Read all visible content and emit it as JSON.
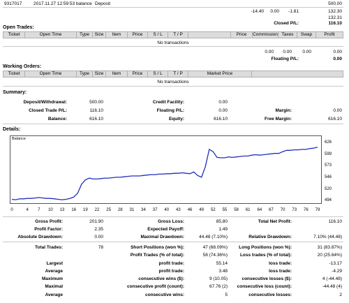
{
  "header": {
    "account": "9317017",
    "datetime": "2017.11.27 12:59:53",
    "kind": "balance",
    "comment": "Deposit",
    "amount": "500.00",
    "sum_commission": "-14.40",
    "sum_taxes": "0.00",
    "sum_swap": "-1.81",
    "sum_profit": "132.30",
    "sum_total": "132.31",
    "closed_label": "Closed P/L:",
    "closed_value": "116.10"
  },
  "open_trades": {
    "title": "Open Trades:",
    "columns": [
      "Ticket",
      "Open Time",
      "Type",
      "Size",
      "Item",
      "Price",
      "S / L",
      "T / P",
      "",
      "Price",
      "Commission",
      "Taxes",
      "Swap",
      "Profit"
    ],
    "empty": "No transactions",
    "totals": [
      "0.00",
      "0.00",
      "0.00",
      "0.00"
    ],
    "floating_label": "Floating P/L:",
    "floating_value": "0.00"
  },
  "working_orders": {
    "title": "Working Orders:",
    "columns": [
      "Ticket",
      "Open Time",
      "Type",
      "Size",
      "Item",
      "Price",
      "S / L",
      "T / P",
      "Market Price"
    ],
    "empty": "No transactions"
  },
  "summary": {
    "title": "Summary:",
    "deposit_label": "Deposit/Withdrawal:",
    "deposit_value": "500.00",
    "credit_label": "Credit Facility:",
    "credit_value": "0.00",
    "closed_label": "Closed Trade P/L:",
    "closed_value": "116.10",
    "floating_label": "Floating P/L:",
    "floating_value": "0.00",
    "margin_label": "Margin:",
    "margin_value": "0.00",
    "balance_label": "Balance:",
    "balance_value": "616.10",
    "equity_label": "Equity:",
    "equity_value": "616.10",
    "free_label": "Free Margin:",
    "free_value": "616.10"
  },
  "details": {
    "title": "Details:",
    "chart_legend": "Balance"
  },
  "chart_data": {
    "type": "line",
    "title": "",
    "series": [
      {
        "name": "Balance",
        "x": [
          0,
          1,
          2,
          3,
          4,
          5,
          6,
          7,
          8,
          9,
          10,
          11,
          12,
          13,
          14,
          15,
          16,
          17,
          18,
          19,
          20,
          21,
          22,
          23,
          24,
          25,
          26,
          27,
          28,
          29,
          30,
          31,
          32,
          33,
          34,
          35,
          36,
          37,
          38,
          39,
          40,
          41,
          42,
          43,
          44,
          45,
          46,
          47,
          48,
          49,
          50,
          51,
          52,
          53,
          54,
          55,
          56,
          57,
          58,
          59,
          60,
          61,
          62,
          63,
          64,
          65,
          66,
          67,
          68,
          69,
          70,
          71,
          72,
          73,
          74,
          75,
          76,
          77,
          78,
          79
        ],
        "values": [
          498,
          497,
          499,
          499,
          500,
          500,
          501,
          502,
          501,
          500,
          500,
          499,
          498,
          497,
          498,
          500,
          503,
          512,
          532,
          542,
          546,
          544,
          544,
          545,
          546,
          546,
          547,
          548,
          548,
          549,
          550,
          551,
          551,
          551,
          552,
          553,
          554,
          554,
          555,
          555,
          556,
          556,
          557,
          557,
          558,
          557,
          556,
          560,
          552,
          548,
          572,
          611,
          606,
          593,
          592,
          592,
          594,
          593,
          594,
          595,
          596,
          596,
          598,
          599,
          598,
          599,
          600,
          601,
          602,
          602,
          606,
          609,
          609,
          610,
          610,
          611,
          611,
          613,
          614,
          616
        ]
      }
    ],
    "x_ticks": [
      "0",
      "4",
      "7",
      "10",
      "13",
      "16",
      "19",
      "22",
      "25",
      "28",
      "31",
      "34",
      "37",
      "40",
      "43",
      "46",
      "49",
      "52",
      "55",
      "58",
      "61",
      "64",
      "67",
      "70",
      "73",
      "76",
      "79"
    ],
    "y_ticks": [
      "626",
      "599",
      "573",
      "546",
      "520",
      "494"
    ],
    "ylim": [
      494,
      630
    ],
    "xlim": [
      0,
      79
    ],
    "grid": false
  },
  "stats": {
    "gross_profit_label": "Gross Profit:",
    "gross_profit": "201.90",
    "gross_loss_label": "Gross Loss:",
    "gross_loss": "85.80",
    "net_profit_label": "Total Net Profit:",
    "net_profit": "116.10",
    "profit_factor_label": "Profit Factor:",
    "profit_factor": "2.35",
    "expected_payoff_label": "Expected Payoff:",
    "expected_payoff": "1.49",
    "abs_dd_label": "Absolute Drawdown:",
    "abs_dd": "0.00",
    "max_dd_label": "Maximal Drawdown:",
    "max_dd": "44.48 (7.10%)",
    "rel_dd_label": "Relative Drawdown:",
    "rel_dd": "7.10% (44.48)",
    "total_trades_label": "Total Trades:",
    "total_trades": "78",
    "short_label": "Short Positions (won %):",
    "short": "47 (68.09%)",
    "long_label": "Long Positions (won %):",
    "long": "31 (83.87%)",
    "profit_trades_label": "Profit Trades (% of total):",
    "profit_trades": "58 (74.36%)",
    "loss_trades_label": "Loss trades (% of total):",
    "loss_trades": "20 (25.64%)",
    "largest": "Largest",
    "largest_profit_label": "profit trade:",
    "largest_profit": "55.14",
    "largest_loss_label": "loss trade:",
    "largest_loss": "-13.17",
    "average": "Average",
    "avg_profit_label": "profit trade:",
    "avg_profit": "3.48",
    "avg_loss_label": "loss trade:",
    "avg_loss": "-4.29",
    "maximum": "Maximum",
    "max_wins_label": "consecutive wins ($):",
    "max_wins": "9 (10.05)",
    "max_losses_label": "consecutive losses ($):",
    "max_losses": "4 (-44.48)",
    "maximal": "Maximal",
    "maxl_profit_label": "consecutive profit (count):",
    "maxl_profit": "67.76 (2)",
    "maxl_loss_label": "consecutive loss (count):",
    "maxl_loss": "-44.48 (4)",
    "average2": "Average",
    "avg_wins_label": "consecutive wins:",
    "avg_wins": "5",
    "avg_losses_label": "consecutive losses:",
    "avg_losses": "2"
  }
}
